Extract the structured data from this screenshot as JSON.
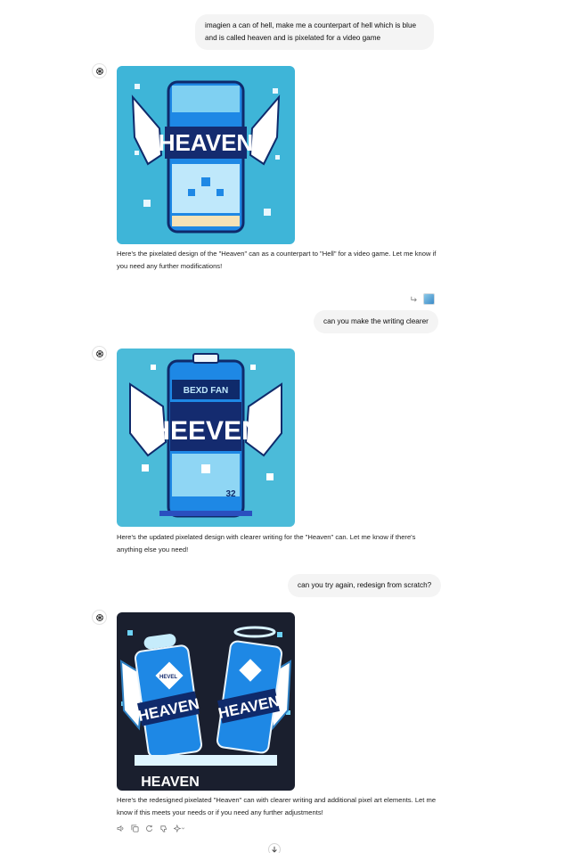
{
  "conversation": {
    "messages": [
      {
        "role": "user",
        "text": "imagien a can of hell, make me a counterpart of hell which is blue and is called heaven and is pixelated for a video game"
      },
      {
        "role": "assistant",
        "image": {
          "can_label": "HEAVEN",
          "icon": "heaven-can-image"
        },
        "text": "Here's the pixelated design of the \"Heaven\" can as a counterpart to \"Hell\" for a video game. Let me know if you need any further modifications!"
      },
      {
        "role": "user",
        "text": "can you make the writing clearer"
      },
      {
        "role": "assistant",
        "image": {
          "can_label": "HEEVEN",
          "top_label": "BEXD FAN",
          "number": "32",
          "icon": "heaven-can-image"
        },
        "text": "Here's the updated pixelated design with clearer writing for the \"Heaven\" can. Let me know if there's anything else you need!"
      },
      {
        "role": "user",
        "text": "can you try again, redesign from scratch?"
      },
      {
        "role": "assistant",
        "image": {
          "can_label": "HEAVEN",
          "badge_label": "HEVEL",
          "bottom_label": "HEAVEN",
          "icon": "heaven-cans-image"
        },
        "text": "Here's the redesigned pixelated \"Heaven\" can with clearer writing and additional pixel art elements. Let me know if this meets your needs or if you need any further adjustments!"
      }
    ]
  },
  "colors": {
    "user_bubble": "#f4f4f4",
    "image_bg_light": "#4db8d8",
    "image_bg_dark": "#1a1f2e",
    "can_blue": "#1e88e5",
    "can_dark": "#142b6f"
  },
  "icons": {
    "avatar": "openai-logo-icon",
    "edit": "edit-arrow-icon",
    "actions": [
      "speaker-icon",
      "copy-icon",
      "regenerate-icon",
      "thumbs-down-icon",
      "sparkle-model-icon"
    ],
    "scroll": "arrow-down-icon"
  }
}
